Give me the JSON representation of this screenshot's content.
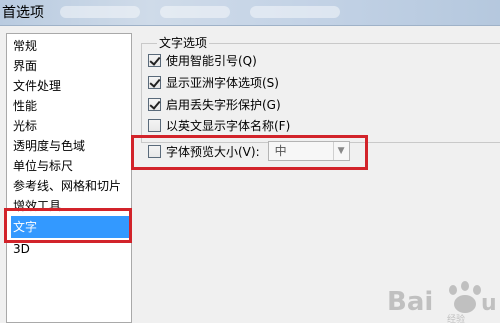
{
  "window": {
    "title": "首选项"
  },
  "sidebar": {
    "items": [
      {
        "label": "常规"
      },
      {
        "label": "界面"
      },
      {
        "label": "文件处理"
      },
      {
        "label": "性能"
      },
      {
        "label": "光标"
      },
      {
        "label": "透明度与色域"
      },
      {
        "label": "单位与标尺"
      },
      {
        "label": "参考线、网格和切片"
      },
      {
        "label": "增效工具"
      },
      {
        "label": "文字",
        "selected": true
      },
      {
        "label": "3D"
      }
    ]
  },
  "text_options": {
    "group_title": "文字选项",
    "options": [
      {
        "label": "使用智能引号(Q)",
        "checked": true
      },
      {
        "label": "显示亚洲字体选项(S)",
        "checked": true
      },
      {
        "label": "启用丢失字形保护(G)",
        "checked": true
      },
      {
        "label": "以英文显示字体名称(F)",
        "checked": false
      }
    ],
    "font_preview": {
      "label": "字体预览大小(V):",
      "checked": false,
      "selected_value": "中"
    }
  },
  "watermark": {
    "text": "Baidu经验"
  },
  "colors": {
    "selection": "#3399ff",
    "highlight_box": "#d2232a"
  }
}
